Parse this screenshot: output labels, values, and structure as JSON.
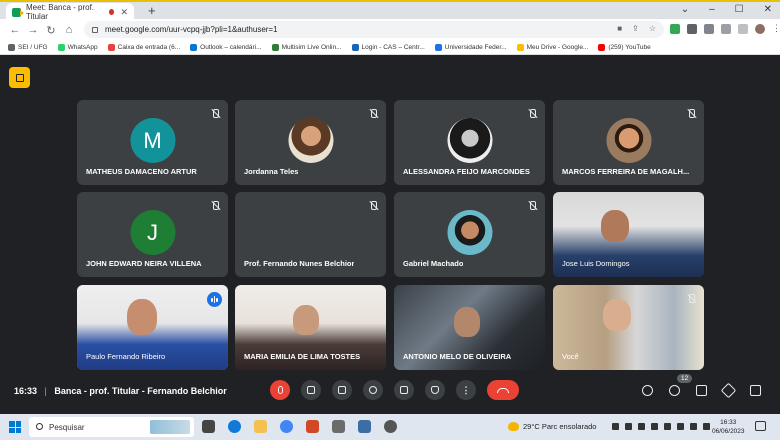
{
  "browser": {
    "tab_title": "Meet: Banca - prof. Titular",
    "url": "meet.google.com/uur-vcpq-jjb?pli=1&authuser=1",
    "bookmarks": [
      {
        "label": "SEI / UFG",
        "color": "#5f6368"
      },
      {
        "label": "WhatsApp",
        "color": "#25d366"
      },
      {
        "label": "Caixa de entrada (6...",
        "color": "#ea4335"
      },
      {
        "label": "Outlook – calendári...",
        "color": "#0078d4"
      },
      {
        "label": "Multisim Live Onlin...",
        "color": "#2e7d32"
      },
      {
        "label": "Login - CAS – Centr...",
        "color": "#1565c0"
      },
      {
        "label": "Universidade Feder...",
        "color": "#1a73e8"
      },
      {
        "label": "Meu Drive - Google...",
        "color": "#fbbc04"
      },
      {
        "label": "(259) YouTube",
        "color": "#ff0000"
      }
    ]
  },
  "participants": [
    {
      "name": "MATHEUS DAMACENO ARTUR",
      "type": "initial",
      "initial": "M",
      "color": "#12939a",
      "muted": true
    },
    {
      "name": "Jordanna Teles",
      "type": "photo",
      "muted": true
    },
    {
      "name": "ALESSANDRA FEIJO MARCONDES",
      "type": "photo",
      "muted": true
    },
    {
      "name": "MARCOS FERREIRA DE MAGALH...",
      "type": "photo",
      "muted": true
    },
    {
      "name": "JOHN EDWARD NEIRA VILLENA",
      "type": "initial",
      "initial": "J",
      "color": "#1e7e34",
      "muted": true
    },
    {
      "name": "Prof. Fernando Nunes Belchior",
      "type": "photo",
      "muted": true
    },
    {
      "name": "Gabriel Machado",
      "type": "photo",
      "muted": true
    },
    {
      "name": "Jose Luis Domingos",
      "type": "video",
      "muted": false
    },
    {
      "name": "Paulo Fernando Ribeiro",
      "type": "video",
      "muted": false,
      "speaking": true
    },
    {
      "name": "MARIA EMILIA DE LIMA TOSTES",
      "type": "video",
      "muted": false
    },
    {
      "name": "ANTONIO MELO DE OLIVEIRA",
      "type": "video",
      "muted": false
    },
    {
      "name": "Você",
      "type": "video",
      "muted": true
    }
  ],
  "meeting": {
    "time": "16:33",
    "separator": "|",
    "title": "Banca - prof. Titular - Fernando Belchior",
    "participant_count": "12"
  },
  "taskbar": {
    "search_placeholder": "Pesquisar",
    "weather": "29°C  Parc ensolarado",
    "time": "16:33",
    "date": "06/06/2023"
  }
}
